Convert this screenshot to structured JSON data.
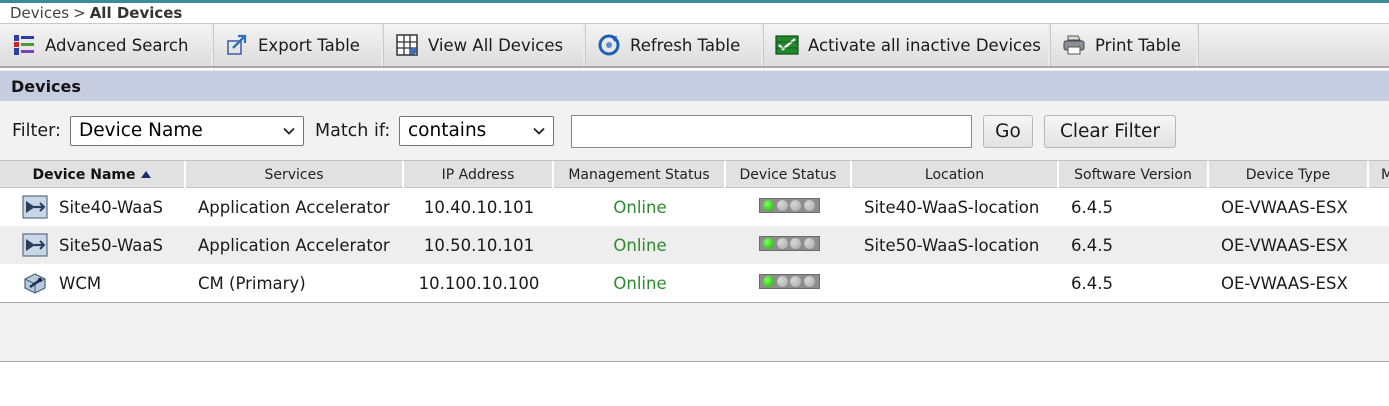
{
  "breadcrumb": {
    "parent": "Devices",
    "separator": ">",
    "current": "All Devices"
  },
  "toolbar": {
    "items": [
      {
        "label": "Advanced Search",
        "icon": "advanced-search-icon"
      },
      {
        "label": "Export Table",
        "icon": "export-icon"
      },
      {
        "label": "View All Devices",
        "icon": "view-all-devices-icon"
      },
      {
        "label": "Refresh Table",
        "icon": "refresh-icon"
      },
      {
        "label": "Activate all inactive Devices",
        "icon": "activate-devices-icon"
      },
      {
        "label": "Print Table",
        "icon": "printer-icon"
      }
    ]
  },
  "section": {
    "title": "Devices"
  },
  "filter": {
    "filter_label": "Filter:",
    "field_value": "Device Name",
    "match_label": "Match if:",
    "match_value": "contains",
    "text_value": "",
    "go_label": "Go",
    "clear_label": "Clear Filter"
  },
  "table": {
    "columns": [
      {
        "label": "Device Name",
        "sorted": "ascending"
      },
      {
        "label": "Services"
      },
      {
        "label": "IP Address"
      },
      {
        "label": "Management Status"
      },
      {
        "label": "Device Status"
      },
      {
        "label": "Location"
      },
      {
        "label": "Software Version"
      },
      {
        "label": "Device Type"
      },
      {
        "label": "M"
      }
    ],
    "rows": [
      {
        "icon": "accelerator-device-icon",
        "name": "Site40-WaaS",
        "services": "Application Accelerator",
        "ip": "10.40.10.101",
        "mgmt_status": "Online",
        "device_status_leds": [
          "green",
          "grey",
          "grey",
          "grey"
        ],
        "location": "Site40-WaaS-location",
        "version": "6.4.5",
        "type": "OE-VWAAS-ESX"
      },
      {
        "icon": "accelerator-device-icon",
        "name": "Site50-WaaS",
        "services": "Application Accelerator",
        "ip": "10.50.10.101",
        "mgmt_status": "Online",
        "device_status_leds": [
          "green",
          "grey",
          "grey",
          "grey"
        ],
        "location": "Site50-WaaS-location",
        "version": "6.4.5",
        "type": "OE-VWAAS-ESX"
      },
      {
        "icon": "central-manager-icon",
        "name": "WCM",
        "services": "CM (Primary)",
        "ip": "10.100.10.100",
        "mgmt_status": "Online",
        "device_status_leds": [
          "green",
          "grey",
          "grey",
          "grey"
        ],
        "location": "",
        "version": "6.4.5",
        "type": "OE-VWAAS-ESX"
      }
    ]
  },
  "colors": {
    "online": "#2d8a2d",
    "section_header": "#c6cde0",
    "led_on": "#17b000"
  }
}
